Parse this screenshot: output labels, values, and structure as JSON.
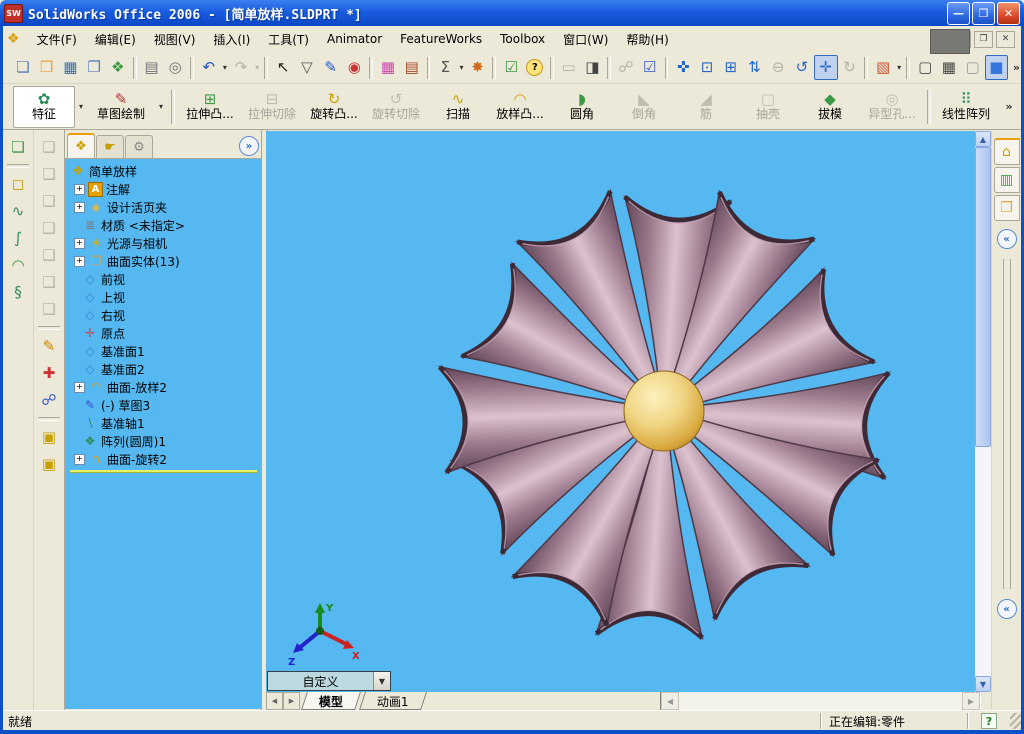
{
  "window": {
    "title": "SolidWorks Office 2006 - [简单放样.SLDPRT *]",
    "icon_text": "SW"
  },
  "ui": {
    "min_glyph": "—",
    "max_glyph": "❐",
    "close_glyph": "✕",
    "doc_min": "—",
    "doc_restore": "❐",
    "doc_close": "✕",
    "dropdown_glyph": "▾",
    "overflow_glyph": "»",
    "plus_glyph": "+",
    "chevron_left": "«",
    "chevron_right": "»",
    "scroll_up": "▲",
    "scroll_down": "▼",
    "scroll_left": "◀",
    "scroll_right": "▶"
  },
  "menu": {
    "icon_glyph": "❖",
    "items": [
      "文件(F)",
      "编辑(E)",
      "视图(V)",
      "插入(I)",
      "工具(T)",
      "Animator",
      "FeatureWorks",
      "Toolbox",
      "窗口(W)",
      "帮助(H)"
    ]
  },
  "std_toolbar": {
    "buttons": [
      {
        "name": "new-document",
        "glyph": "❏"
      },
      {
        "name": "open-folder",
        "glyph": "❒"
      },
      {
        "name": "save",
        "glyph": "▦"
      },
      {
        "name": "make-drawing-from-part",
        "glyph": "❐"
      },
      {
        "name": "make-assembly-from-part",
        "glyph": "❖"
      },
      {
        "name": "print",
        "glyph": "▤"
      },
      {
        "name": "print-preview",
        "glyph": "◎"
      },
      {
        "name": "undo",
        "glyph": "↶"
      },
      {
        "name": "redo",
        "glyph": "↷"
      },
      {
        "name": "select",
        "glyph": "↖"
      },
      {
        "name": "selection-filter",
        "glyph": "▽"
      },
      {
        "name": "sketch",
        "glyph": "✎"
      },
      {
        "name": "traffic-light",
        "glyph": "◉"
      },
      {
        "name": "color-palette",
        "glyph": "▦"
      },
      {
        "name": "texture",
        "glyph": "▤"
      },
      {
        "name": "measure",
        "glyph": "Σ"
      },
      {
        "name": "curvature",
        "glyph": "✸"
      },
      {
        "name": "design-checker",
        "glyph": "☑"
      },
      {
        "name": "help",
        "glyph": "?"
      },
      {
        "name": "edrawings-publish",
        "glyph": "▭"
      },
      {
        "name": "edrawings-animate",
        "glyph": "◨"
      },
      {
        "name": "dependency-viewer",
        "glyph": "☍"
      },
      {
        "name": "custom-check",
        "glyph": "☑"
      },
      {
        "name": "zoom-to-selection",
        "glyph": "✜"
      },
      {
        "name": "zoom-to-fit",
        "glyph": "⊡"
      },
      {
        "name": "zoom-to-area",
        "glyph": "⊞"
      },
      {
        "name": "zoom-in-out",
        "glyph": "⇅"
      },
      {
        "name": "zoom-previous",
        "glyph": "⊖"
      },
      {
        "name": "rotate-view",
        "glyph": "↺"
      },
      {
        "name": "pan",
        "glyph": "✛"
      },
      {
        "name": "rotate-about-axis",
        "glyph": "↻"
      },
      {
        "name": "view-orientation",
        "glyph": "▧"
      },
      {
        "name": "wireframe",
        "glyph": "▢"
      },
      {
        "name": "hidden-lines-visible",
        "glyph": "▦"
      },
      {
        "name": "hidden-lines-removed",
        "glyph": "▢"
      },
      {
        "name": "shaded",
        "glyph": "■"
      }
    ]
  },
  "features_toolbar": {
    "buttons": [
      {
        "name": "features-group",
        "label": "特征",
        "glyph": "✿"
      },
      {
        "name": "sketch-group",
        "label": "草图绘制",
        "glyph": "✎"
      },
      {
        "name": "extruded-boss",
        "label": "拉伸凸...",
        "glyph": "⊞"
      },
      {
        "name": "extruded-cut",
        "label": "拉伸切除",
        "glyph": "⊟"
      },
      {
        "name": "revolved-boss",
        "label": "旋转凸...",
        "glyph": "↻"
      },
      {
        "name": "revolved-cut",
        "label": "旋转切除",
        "glyph": "↺"
      },
      {
        "name": "sweep",
        "label": "扫描",
        "glyph": "∿"
      },
      {
        "name": "loft",
        "label": "放样凸...",
        "glyph": "◠"
      },
      {
        "name": "fillet",
        "label": "圆角",
        "glyph": "◗"
      },
      {
        "name": "chamfer",
        "label": "倒角",
        "glyph": "◣"
      },
      {
        "name": "rib",
        "label": "筋",
        "glyph": "◢"
      },
      {
        "name": "shell",
        "label": "抽壳",
        "glyph": "▢"
      },
      {
        "name": "draft",
        "label": "拔模",
        "glyph": "◆"
      },
      {
        "name": "hole-wizard",
        "label": "异型孔...",
        "glyph": "◎"
      },
      {
        "name": "linear-pattern",
        "label": "线性阵列",
        "glyph": "⠿"
      }
    ]
  },
  "surfaces_toolbar": {
    "buttons": [
      {
        "name": "planar-surface",
        "glyph": "❏"
      },
      {
        "name": "extruded-surface",
        "glyph": "◻"
      },
      {
        "name": "curve-3d",
        "glyph": "∿"
      },
      {
        "name": "swept-surface",
        "glyph": "∫"
      },
      {
        "name": "lofted-surface",
        "glyph": "◠"
      },
      {
        "name": "helix-curve",
        "glyph": "§"
      }
    ]
  },
  "views_toolbar": {
    "buttons": [
      {
        "name": "view-cube-front",
        "glyph": "❑"
      },
      {
        "name": "view-cube-back",
        "glyph": "❑"
      },
      {
        "name": "view-cube-left",
        "glyph": "❑"
      },
      {
        "name": "view-cube-right",
        "glyph": "❑"
      },
      {
        "name": "view-cube-top",
        "glyph": "❑"
      },
      {
        "name": "view-cube-bottom",
        "glyph": "❑"
      },
      {
        "name": "view-cube-iso",
        "glyph": "❑"
      },
      {
        "name": "new-sketch",
        "glyph": "✎"
      },
      {
        "name": "edit-sketch",
        "glyph": "✚"
      },
      {
        "name": "derived-sketch",
        "glyph": "☍"
      },
      {
        "name": "convert-entities",
        "glyph": "▣"
      },
      {
        "name": "offset-entities",
        "glyph": "▣"
      }
    ]
  },
  "tree": {
    "tabs": [
      {
        "name": "feature-manager",
        "glyph": "❖"
      },
      {
        "name": "property-manager",
        "glyph": "☛"
      },
      {
        "name": "configuration-manager",
        "glyph": "⚙"
      }
    ],
    "items": [
      {
        "label": "简单放样",
        "glyph": "❖",
        "plus": false
      },
      {
        "label": "注解",
        "glyph": "A",
        "plus": true
      },
      {
        "label": "设计活页夹",
        "glyph": "◈",
        "plus": true
      },
      {
        "label": "材质 <未指定>",
        "glyph": "≣",
        "plus": false
      },
      {
        "label": "光源与相机",
        "glyph": "☀",
        "plus": true
      },
      {
        "label": "曲面实体(13)",
        "glyph": "❒",
        "plus": true
      },
      {
        "label": "前视",
        "glyph": "◇",
        "plus": false
      },
      {
        "label": "上视",
        "glyph": "◇",
        "plus": false
      },
      {
        "label": "右视",
        "glyph": "◇",
        "plus": false
      },
      {
        "label": "原点",
        "glyph": "✛",
        "plus": false
      },
      {
        "label": "基准面1",
        "glyph": "◇",
        "plus": false
      },
      {
        "label": "基准面2",
        "glyph": "◇",
        "plus": false
      },
      {
        "label": "曲面-放样2",
        "glyph": "◠",
        "plus": true
      },
      {
        "label": "(-) 草图3",
        "glyph": "✎",
        "plus": false
      },
      {
        "label": "基准轴1",
        "glyph": "∖",
        "plus": false
      },
      {
        "label": "阵列(圆周)1",
        "glyph": "❖",
        "plus": false
      },
      {
        "label": "曲面-旋转2",
        "glyph": "∩",
        "plus": true
      }
    ]
  },
  "viewport": {
    "background": "#55B8F1",
    "orientation_combo": "自定义",
    "triad": {
      "x": "X",
      "y": "Y",
      "z": "Z"
    },
    "model": {
      "petal_count": 12,
      "petal_color_dark": "#5A3F52",
      "petal_color_mid": "#9C7B8D",
      "petal_color_light": "#DCC2CF",
      "sphere_color": "#E8C96A"
    }
  },
  "taskpane": {
    "buttons": [
      {
        "name": "solidworks-resources",
        "glyph": "⌂"
      },
      {
        "name": "design-library",
        "glyph": "▥"
      },
      {
        "name": "file-explorer",
        "glyph": "❒"
      }
    ]
  },
  "doc_tabs": {
    "model": "模型",
    "animation": "动画1"
  },
  "status": {
    "ready": "就绪",
    "editing": "正在编辑:零件",
    "help_glyph": "?"
  }
}
